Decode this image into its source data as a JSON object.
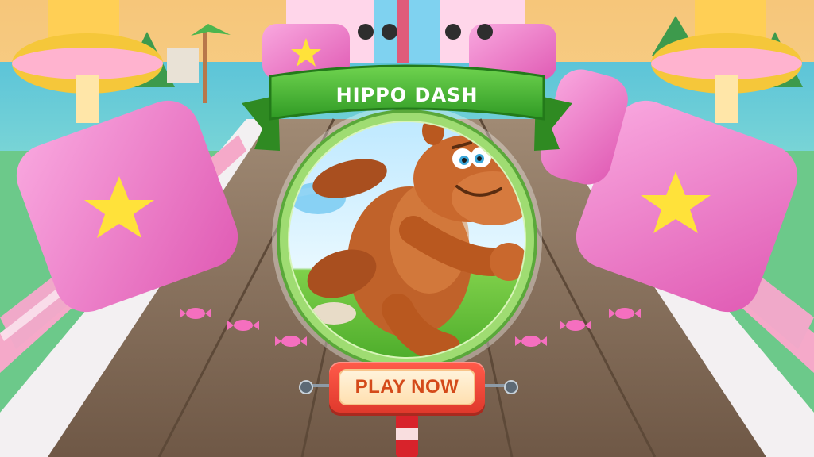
{
  "game": {
    "title": "HIPPO DASH",
    "play_button_label": "PLAY NOW"
  },
  "colors": {
    "sky": "#f6c67a",
    "ribbon_green": "#3fae2f",
    "ring_green": "#8fd36a",
    "candy_pink": "#f277c6",
    "star_yellow": "#ffe23a",
    "track_wood": "#8a6f58",
    "button_red": "#e8402f",
    "button_text": "#d44a1a"
  },
  "icons": {
    "character": "hippo-character-icon",
    "star": "star-icon",
    "candy": "candy-icon"
  }
}
